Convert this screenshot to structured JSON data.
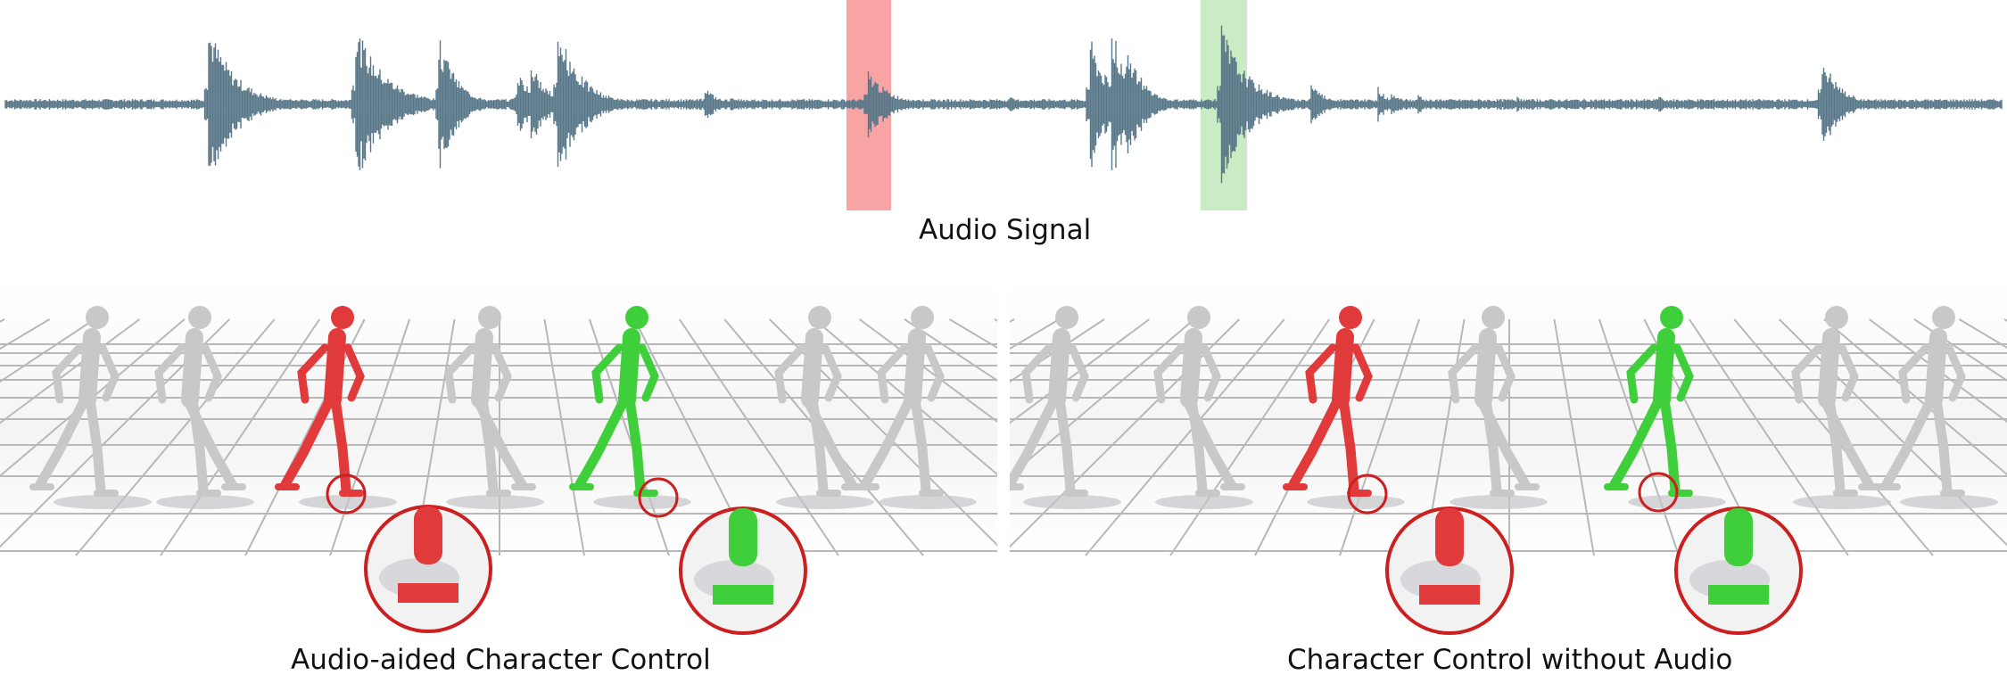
{
  "audio": {
    "label": "Audio Signal",
    "waveform_color": "#587788",
    "highlight_red": "#f8a4a4",
    "highlight_green": "#c9ecc4"
  },
  "panels": [
    {
      "id": "audio-aided",
      "caption": "Audio-aided Character Control"
    },
    {
      "id": "without-audio",
      "caption": "Character Control without Audio"
    }
  ],
  "colors": {
    "red_character": "#e03a3a",
    "green_character": "#3fcf3a",
    "gray_character": "#c8c8c8",
    "zoom_circle": "#cc1f1f",
    "grid": "#b8b8b8"
  },
  "icons": {
    "character": "stick-figure-character",
    "zoom": "magnifier-circle"
  }
}
